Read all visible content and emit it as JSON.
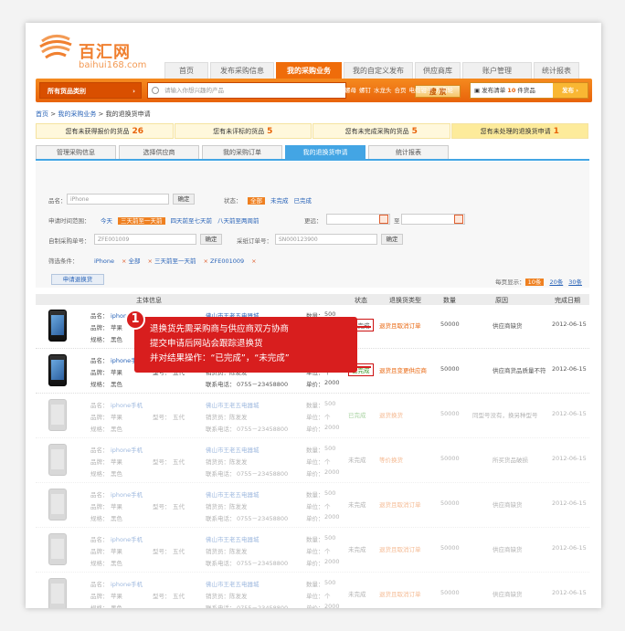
{
  "brand": {
    "name": "百汇网",
    "domain": "baihui168.com",
    "color": "#f08030"
  },
  "nav": [
    {
      "label": "首页",
      "active": false,
      "w": 48
    },
    {
      "label": "发布采购信息",
      "active": false,
      "w": 70
    },
    {
      "label": "我的采购业务",
      "active": true,
      "w": 72
    },
    {
      "label": "我的自定义发布",
      "active": false,
      "w": 76
    },
    {
      "label": "供应商库",
      "active": false,
      "w": 50
    },
    {
      "label": "账户管理",
      "active": false,
      "w": 76
    },
    {
      "label": "统计报表",
      "active": false,
      "w": 50
    }
  ],
  "toolbar": {
    "category_label": "所有货品类别",
    "search_placeholder": "请输入你想兴趣的产品",
    "search_button": "搜 索",
    "hot_words": [
      "螺母",
      "螺钉",
      "水龙头",
      "合页",
      "电缆钳子",
      "万向轮"
    ],
    "purchase_list_prefix": "发布清单",
    "purchase_list_count": "10",
    "purchase_list_suffix": "件货品",
    "publish_button": "发布 ›"
  },
  "breadcrumb": {
    "home": "首页",
    "sep1": " > ",
    "section": "我的采购业务",
    "sep2": " > ",
    "current": "我的退换货申请"
  },
  "stats": [
    {
      "label": "您有未获得报价的货品",
      "value": "26"
    },
    {
      "label": "您有未评标的货品",
      "value": "5"
    },
    {
      "label": "您有未完成采购的货品",
      "value": "5"
    },
    {
      "label": "您有未处理的退换货申请",
      "value": "1"
    }
  ],
  "subtabs": [
    {
      "label": "管理采购信息",
      "active": false
    },
    {
      "label": "选择供应商",
      "active": false
    },
    {
      "label": "我的采购订单",
      "active": false
    },
    {
      "label": "我的退换货申请",
      "active": true
    },
    {
      "label": "统计报表",
      "active": false
    }
  ],
  "filter": {
    "name_label": "品名：",
    "name_value": "iPhone",
    "confirm": "确定",
    "status_label": "状态：",
    "status_options": [
      "全部",
      "未完成",
      "已完成"
    ],
    "date_label": "申请时间范围：",
    "date_options": [
      "今天",
      "三天前至一天前",
      "四天前至七天前",
      "八天前至两周前"
    ],
    "more_label": "更远：",
    "to_label": "至",
    "own_order_label": "自制采购单号：",
    "own_order_value": "ZFE001009",
    "order_label": "采纸订单号：",
    "order_value": "SN000123900",
    "selected_label": "筛选条件：",
    "selected": [
      "iPhone",
      "全部",
      "三天前至一天前",
      "ZFE001009"
    ],
    "request_button": "申请退换货",
    "per_page_label": "每页显示：",
    "per_page_options": [
      "10条",
      "20条",
      "30条"
    ]
  },
  "table": {
    "headers": [
      "主体信息",
      "状态",
      "退换货类型",
      "数量",
      "原因",
      "完成日期"
    ],
    "field_labels": {
      "name": "品名：",
      "brand": "品牌：",
      "spec": "规格：",
      "model": "型号：",
      "seller": "销货员：",
      "phone": "联系电话：",
      "qty": "数量：",
      "unit": "单位：",
      "price": "单价："
    },
    "rows": [
      {
        "name": "iphone手机",
        "brand": "苹果",
        "spec": "黑色",
        "model": "五代",
        "store": "佛山市王老五电器城",
        "seller": "陈发发",
        "phone": "0755－23458800",
        "qty": "500",
        "unit": "个",
        "price": "2000",
        "status": "未完成",
        "status_color": "orange",
        "type": "退货且取消订单",
        "amount": "50000",
        "reason": "供应商缺货",
        "date": "2012-06-15",
        "dim": false
      },
      {
        "name": "iphone手机",
        "brand": "苹果",
        "spec": "黑色",
        "model": "五代",
        "store": "佛山市王老五电器城",
        "seller": "陈发发",
        "phone": "0755－23458800",
        "qty": "500",
        "unit": "个",
        "price": "2000",
        "status": "已完成",
        "status_color": "green",
        "type": "退货且变更供应商",
        "amount": "50000",
        "reason": "供应商货品质量不符",
        "date": "2012-06-15",
        "dim": false
      },
      {
        "name": "iphone手机",
        "brand": "苹果",
        "spec": "黑色",
        "model": "五代",
        "store": "佛山市王老五电器城",
        "seller": "陈发发",
        "phone": "0755－23458800",
        "qty": "500",
        "unit": "个",
        "price": "2000",
        "status": "已完成",
        "status_color": "green",
        "type": "退货换货",
        "amount": "50000",
        "reason": "同型号没有，换另种型号",
        "date": "2012-06-15",
        "dim": true
      },
      {
        "name": "iphone手机",
        "brand": "苹果",
        "spec": "黑色",
        "model": "五代",
        "store": "佛山市王老五电器城",
        "seller": "陈发发",
        "phone": "0755－23458800",
        "qty": "500",
        "unit": "个",
        "price": "2000",
        "status": "未完成",
        "status_color": "grey",
        "type": "等价换货",
        "amount": "50000",
        "reason": "所买货品破损",
        "date": "2012-06-15",
        "dim": true
      },
      {
        "name": "iphone手机",
        "brand": "苹果",
        "spec": "黑色",
        "model": "五代",
        "store": "佛山市王老五电器城",
        "seller": "陈发发",
        "phone": "0755－23458800",
        "qty": "500",
        "unit": "个",
        "price": "2000",
        "status": "未完成",
        "status_color": "grey",
        "type": "退货且取消订单",
        "amount": "50000",
        "reason": "供应商缺货",
        "date": "2012-06-15",
        "dim": true
      },
      {
        "name": "iphone手机",
        "brand": "苹果",
        "spec": "黑色",
        "model": "五代",
        "store": "佛山市王老五电器城",
        "seller": "陈发发",
        "phone": "0755－23458800",
        "qty": "500",
        "unit": "个",
        "price": "2000",
        "status": "未完成",
        "status_color": "grey",
        "type": "退货且取消订单",
        "amount": "50000",
        "reason": "供应商缺货",
        "date": "2012-06-15",
        "dim": true
      },
      {
        "name": "iphone手机",
        "brand": "苹果",
        "spec": "黑色",
        "model": "五代",
        "store": "佛山市王老五电器城",
        "seller": "陈发发",
        "phone": "0755－23458800",
        "qty": "500",
        "unit": "个",
        "price": "2000",
        "status": "未完成",
        "status_color": "grey",
        "type": "退货且取消订单",
        "amount": "50000",
        "reason": "供应商缺货",
        "date": "2012-06-15",
        "dim": true
      }
    ]
  },
  "callout": {
    "number": "1",
    "lines": [
      "退换货先需采购商与供应商双方协商",
      "提交申请后网站会跟踪退换货",
      "并对结果操作：“已完成”，“未完成”"
    ]
  }
}
